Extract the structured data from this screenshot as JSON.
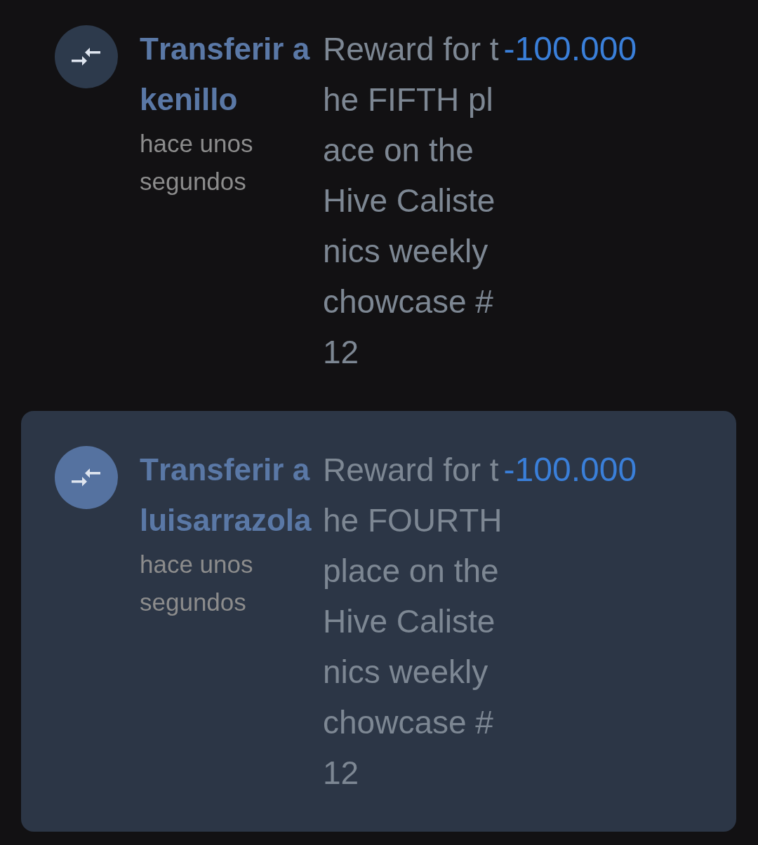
{
  "transactions": [
    {
      "selected": false,
      "title": "Transferir a kenillo",
      "time": "hace unos segundos",
      "memo": "Reward for the FIFTH place on the Hive Calistenics weekly chowcase #12",
      "amount": "-100.000"
    },
    {
      "selected": true,
      "title": "Transferir a luisarrazola",
      "time": "hace unos segundos",
      "memo": "Reward for the FOURTH place on the Hive Calistenics weekly chowcase #12",
      "amount": "-100.000"
    }
  ]
}
